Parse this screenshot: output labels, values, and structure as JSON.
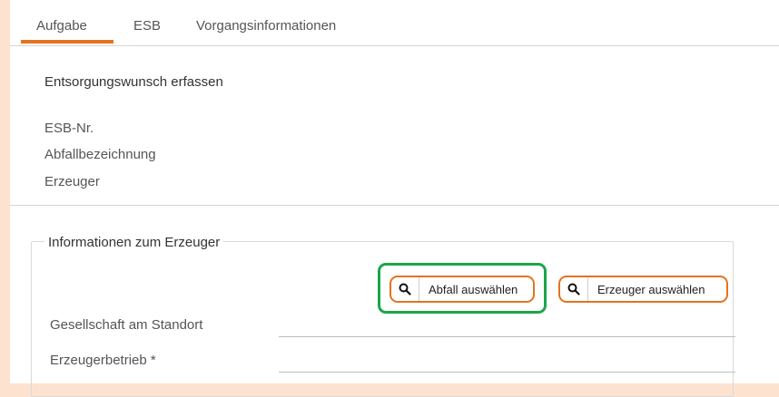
{
  "tabs": {
    "aufgabe": "Aufgabe",
    "esb": "ESB",
    "vorgang": "Vorgangsinformationen",
    "active": "Aufgabe"
  },
  "section": {
    "title": "Entsorgungswunsch erfassen",
    "fields": [
      "ESB-Nr.",
      "Abfallbezeichnung",
      "Erzeuger"
    ]
  },
  "erzeuger_info": {
    "legend": "Informationen zum Erzeuger",
    "abfall_button": "Abfall auswählen",
    "erzeuger_button": "Erzeuger auswählen",
    "gesellschaft_label": "Gesellschaft am Standort",
    "betrieb_label": "Erzeugerbetrieb *",
    "gesellschaft_value": "",
    "betrieb_value": ""
  },
  "colors": {
    "accent": "#e4731f",
    "highlight": "#1aa64a",
    "background": "#fde3cf"
  },
  "icons": {
    "button_icon": "search-icon"
  }
}
